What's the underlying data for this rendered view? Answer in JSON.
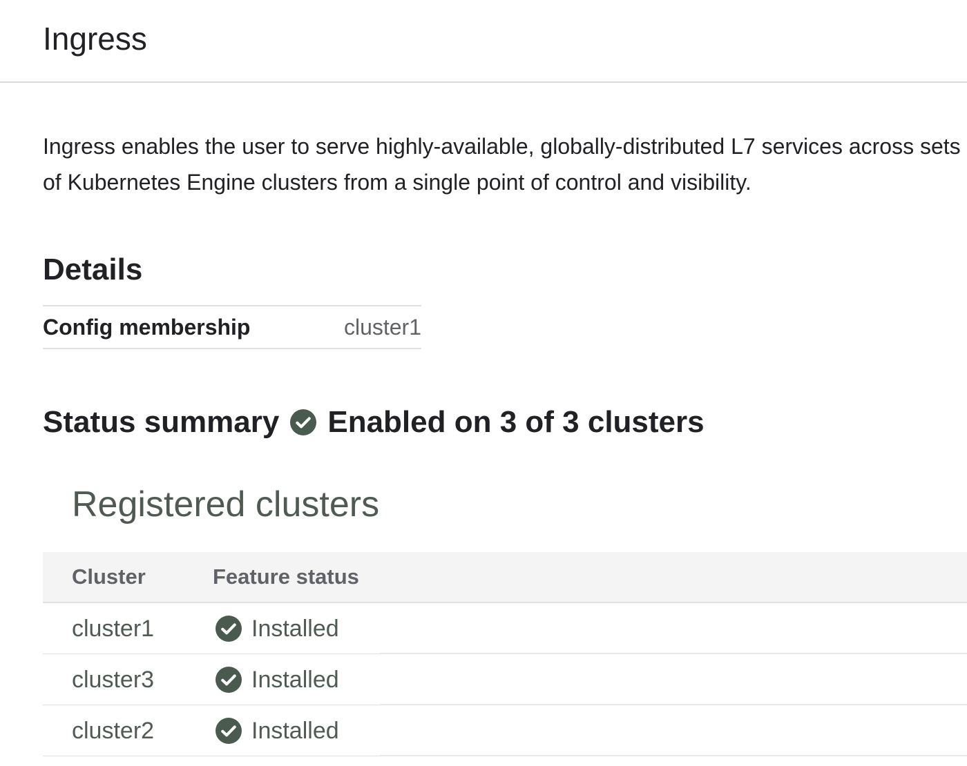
{
  "header": {
    "title": "Ingress"
  },
  "description": "Ingress enables the user to serve highly-available, globally-distributed L7 services across sets of Kubernetes Engine clusters from a single point of control and visibility.",
  "details": {
    "heading": "Details",
    "rows": [
      {
        "key": "Config membership",
        "value": "cluster1"
      }
    ]
  },
  "status_summary": {
    "label": "Status summary",
    "icon": "check-circle-icon",
    "text": "Enabled on 3 of 3 clusters",
    "color": "#4a5a4e"
  },
  "registered_clusters": {
    "heading": "Registered clusters",
    "columns": [
      "Cluster",
      "Feature status"
    ],
    "rows": [
      {
        "cluster": "cluster1",
        "status": "Installed",
        "icon": "check-circle-icon"
      },
      {
        "cluster": "cluster3",
        "status": "Installed",
        "icon": "check-circle-icon"
      },
      {
        "cluster": "cluster2",
        "status": "Installed",
        "icon": "check-circle-icon"
      }
    ]
  }
}
